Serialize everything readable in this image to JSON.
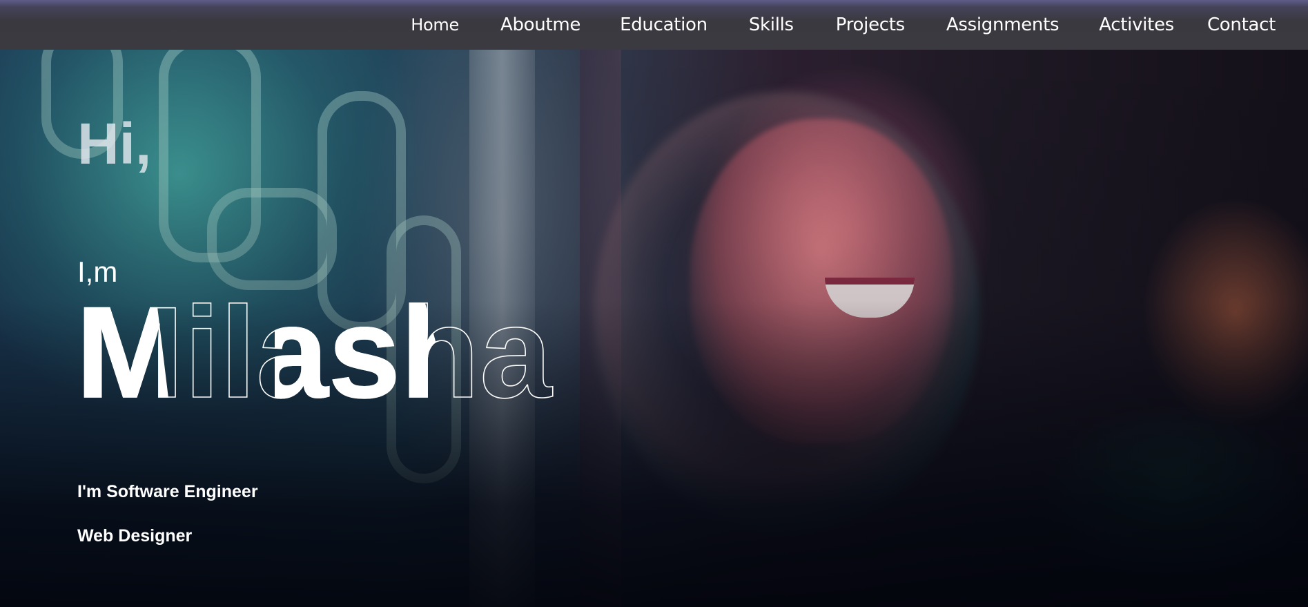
{
  "nav": {
    "items": [
      {
        "label": "Home"
      },
      {
        "label": "Aboutme"
      },
      {
        "label": "Education"
      },
      {
        "label": "Skills"
      },
      {
        "label": "Projects"
      },
      {
        "label": "Assignments"
      },
      {
        "label": "Activites"
      },
      {
        "label": "Contact"
      }
    ],
    "background": "#3b3a41",
    "accent_top": "#5f5c8a"
  },
  "hero": {
    "greeting": "Hi,",
    "intro": "I,m",
    "name": "Milasha",
    "roles": [
      "I'm Software Engineer",
      "Web Designer"
    ],
    "text_color": "#ffffff",
    "background_image": "portrait-photo"
  }
}
